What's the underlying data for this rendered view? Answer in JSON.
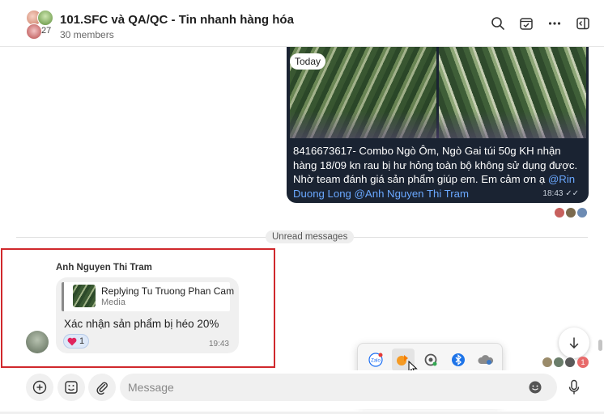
{
  "header": {
    "title": "101.SFC và QA/QC - Tin nhanh hàng hóa",
    "member_count_badge": "27",
    "members_label": "30 members",
    "icons": [
      "search-icon",
      "calendar-check-icon",
      "more-icon",
      "sidebar-toggle-icon"
    ]
  },
  "outgoing_message": {
    "date_pill": "Today",
    "text_before_mention": "8416673617- Combo Ngò Ôm, Ngò Gai túi 50g KH nhận hàng 18/09 kn rau bị hư hỏng toàn bộ không sử dụng được. Nhờ team đánh giá sản phẩm giúp em. Em cảm ơn ạ ",
    "mention1": "@Rin Duong Long",
    "mention2": "@Anh Nguyen Thi Tram",
    "time": "18:43",
    "status": "✓✓"
  },
  "unread_label": "Unread messages",
  "incoming_message": {
    "sender": "Anh Nguyen Thi Tram",
    "reply_title": "Replying Tu Truong Phan Cam",
    "reply_subtitle": "Media",
    "text": "Xác nhận sản phẩm bị héo 20%",
    "reaction_count": "1",
    "time": "19:43"
  },
  "seen_badge": "1",
  "tray_icons": [
    "zalo-app-icon",
    "orange-app-icon",
    "chrome-remote-icon",
    "bluetooth-icon",
    "onedrive-icon",
    "security-shield-icon",
    "office-app-icon"
  ],
  "composer": {
    "placeholder": "Message"
  },
  "colors": {
    "accent_mention": "#6aa8ff",
    "outgoing_bg": "#1a2332",
    "highlight_border": "#d0282c"
  }
}
